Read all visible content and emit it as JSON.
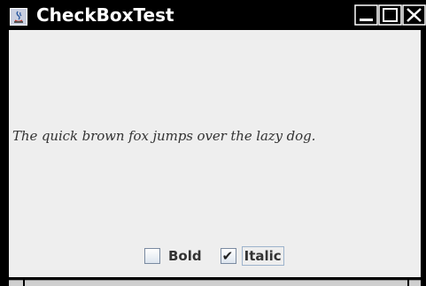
{
  "window": {
    "title": "CheckBoxTest",
    "buttons": {
      "minimize": "minimize-icon",
      "maximize": "maximize-icon",
      "close": "close-icon"
    }
  },
  "content": {
    "message": "The quick brown fox jumps over the lazy dog.",
    "message_style": {
      "bold": false,
      "italic": true
    }
  },
  "checkboxes": {
    "bold": {
      "label": "Bold",
      "checked": false
    },
    "italic": {
      "label": "Italic",
      "checked": true,
      "focused": true
    }
  },
  "colors": {
    "titlebar": "#000000",
    "content_background": "#eeeeee",
    "text": "#333333"
  }
}
